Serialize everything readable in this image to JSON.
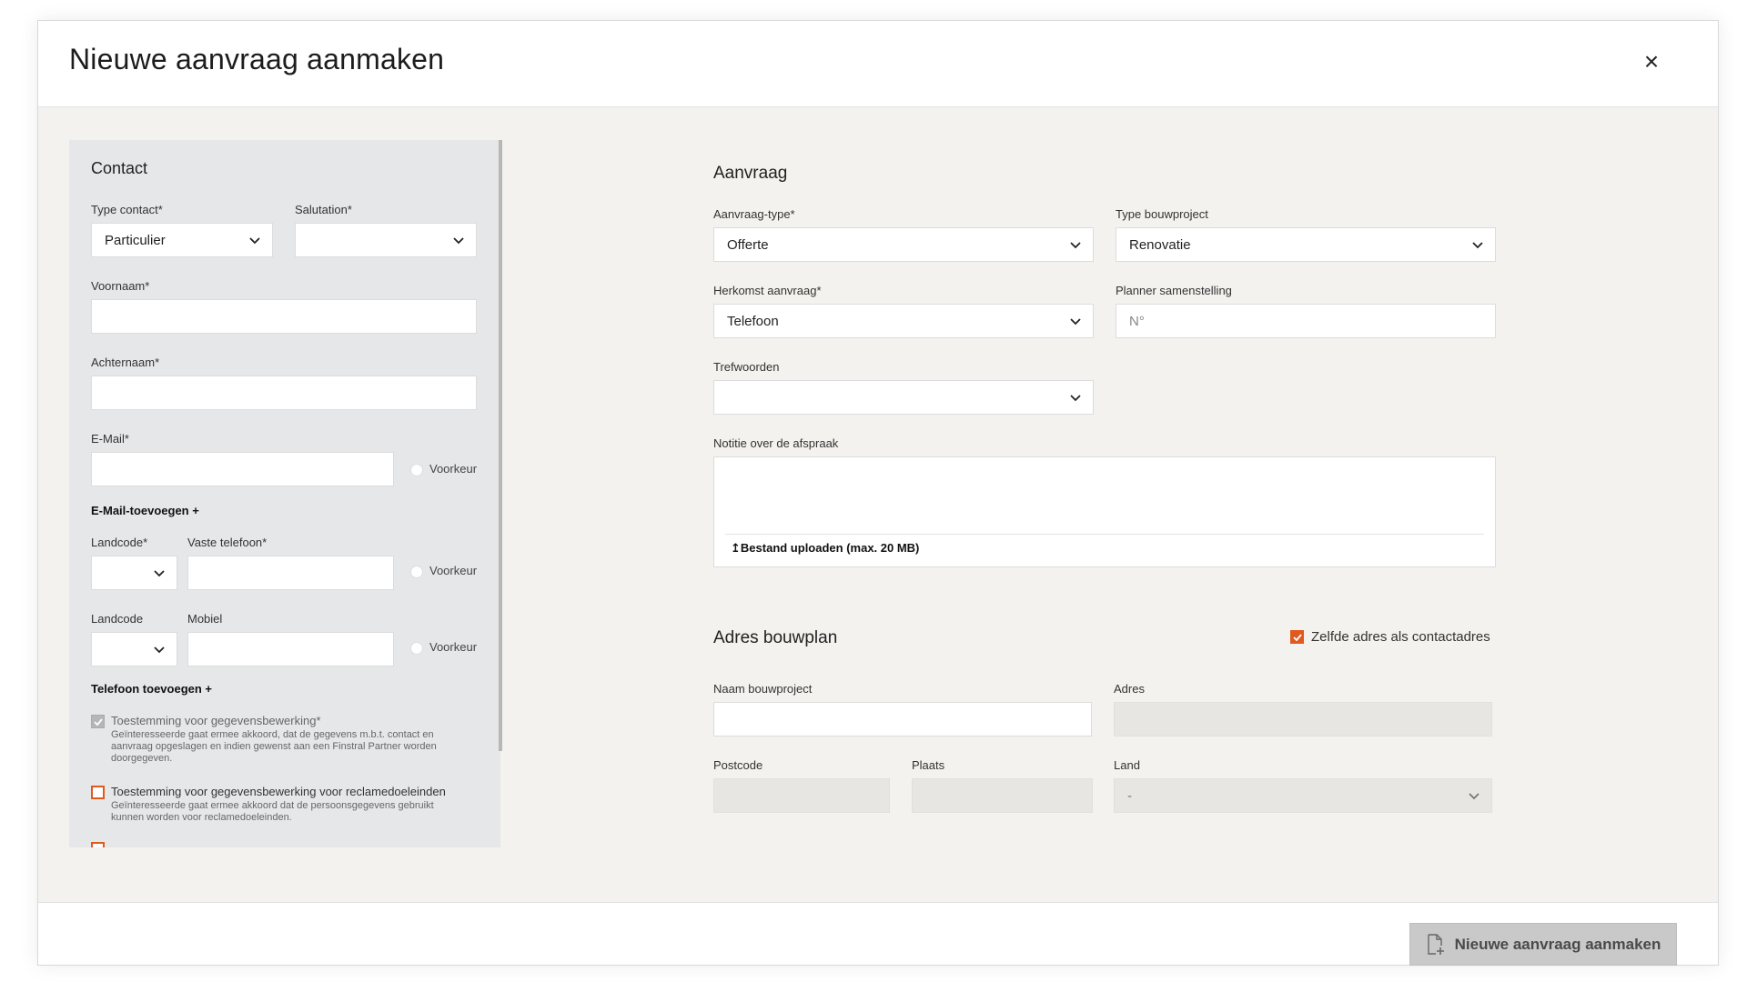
{
  "modal": {
    "title": "Nieuwe aanvraag aanmaken",
    "close_icon": "×",
    "submit_label": "Nieuwe aanvraag aanmaken"
  },
  "contact": {
    "title": "Contact",
    "type_contact": {
      "label": "Type contact*",
      "value": "Particulier"
    },
    "salutation": {
      "label": "Salutation*",
      "value": ""
    },
    "voornaam": {
      "label": "Voornaam*",
      "value": ""
    },
    "achternaam": {
      "label": "Achternaam*",
      "value": ""
    },
    "email": {
      "label": "E-Mail*",
      "value": "",
      "preference_label": "Voorkeur"
    },
    "add_email": "E-Mail-toevoegen +",
    "landcode1": {
      "label": "Landcode*",
      "value": ""
    },
    "vaste_telefoon": {
      "label": "Vaste telefoon*",
      "value": "",
      "preference_label": "Voorkeur"
    },
    "landcode2": {
      "label": "Landcode",
      "value": ""
    },
    "mobiel": {
      "label": "Mobiel",
      "value": "",
      "preference_label": "Voorkeur"
    },
    "add_phone": "Telefoon toevoegen +",
    "consent1": {
      "title": "Toestemming voor gegevensbewerking*",
      "text": "Geïnteresseerde gaat ermee akkoord, dat de gegevens m.b.t. contact en aanvraag opgeslagen en indien gewenst aan een Finstral Partner worden doorgegeven.",
      "checked": true
    },
    "consent2": {
      "title": "Toestemming voor gegevensbewerking voor reclamedoeleinden",
      "text": "Geïnteresseerde gaat ermee akkoord dat de persoonsgegevens gebruikt kunnen worden voor reclamedoeleinden.",
      "checked": false
    }
  },
  "aanvraag": {
    "title": "Aanvraag",
    "aanvraag_type": {
      "label": "Aanvraag-type*",
      "value": "Offerte"
    },
    "type_bouwproject": {
      "label": "Type bouwproject",
      "value": "Renovatie"
    },
    "herkomst": {
      "label": "Herkomst aanvraag*",
      "value": "Telefoon"
    },
    "planner": {
      "label": "Planner samenstelling",
      "placeholder": "N°"
    },
    "trefwoorden": {
      "label": "Trefwoorden",
      "value": ""
    },
    "notitie": {
      "label": "Notitie over de afspraak",
      "value": ""
    },
    "upload_label": "Bestand uploaden (max. 20 MB)"
  },
  "adres": {
    "title": "Adres bouwplan",
    "same_address_label": "Zelfde adres als contactadres",
    "same_address_checked": true,
    "naam_bouwproject": {
      "label": "Naam bouwproject",
      "value": ""
    },
    "adres": {
      "label": "Adres",
      "value": ""
    },
    "postcode": {
      "label": "Postcode",
      "value": ""
    },
    "plaats": {
      "label": "Plaats",
      "value": ""
    },
    "land": {
      "label": "Land",
      "value": "-"
    }
  },
  "colors": {
    "accent": "#e05a1e",
    "panel_bg": "#e6e7e8",
    "body_bg": "#f3f2ef",
    "disabled_button": "#c9c9c9"
  },
  "icons": {
    "close": "close-icon",
    "chevron": "chevron-down-icon",
    "upload": "upload-icon",
    "document": "document-add-icon"
  }
}
